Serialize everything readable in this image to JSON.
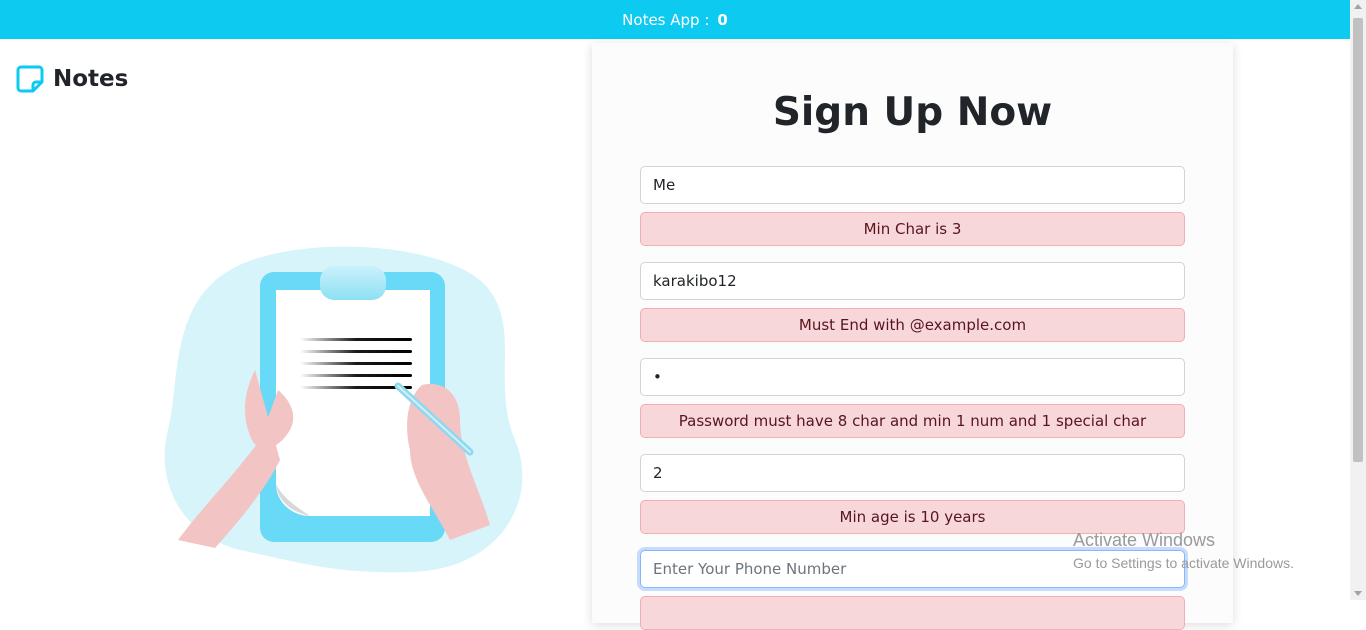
{
  "navbar": {
    "title": "Notes App :",
    "count": "0"
  },
  "brand": {
    "title": "Notes",
    "icon": "sticky-note-icon",
    "color": "#0dcaf0"
  },
  "signup": {
    "heading": "Sign Up Now",
    "name": {
      "value": "Me",
      "error": "Min Char is 3"
    },
    "email": {
      "value": "karakibo12",
      "error": "Must End with @example.com"
    },
    "password": {
      "value": "•",
      "error": "Password must have 8 char and min 1 num and 1 special char"
    },
    "age": {
      "value": "2",
      "error": "Min age is 10 years"
    },
    "phone": {
      "value": "",
      "placeholder": "Enter Your Phone Number"
    }
  },
  "watermark": {
    "line1": "Activate Windows",
    "line2": "Go to Settings to activate Windows."
  },
  "colors": {
    "navbar": "#0dcaf0",
    "error_bg": "#f8d7da",
    "error_text": "#58151c",
    "focus": "#86b7fe"
  }
}
